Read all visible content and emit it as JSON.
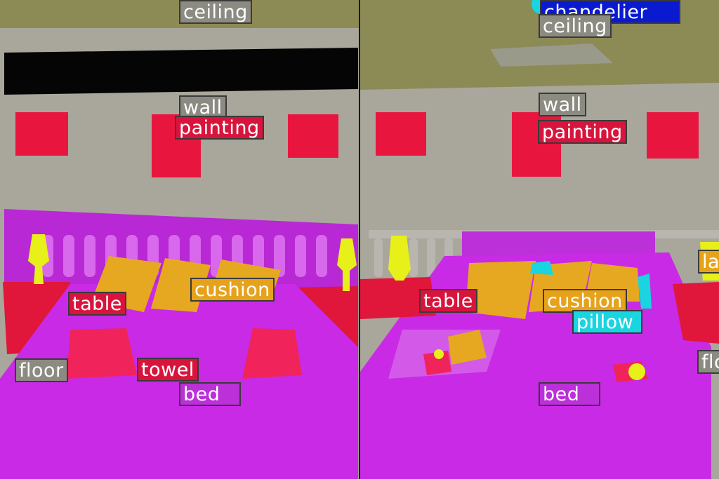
{
  "colors": {
    "wall": "#a9a79c",
    "ceiling": "#8c8a55",
    "painting": "#e8163f",
    "bed": "#c92ae6",
    "cushion": "#e6a820",
    "table": "#e0163a",
    "lamp": "#e8f01a",
    "pillow": "#1ad4e0",
    "chandelier": "#0a1ad0"
  },
  "left_panel": {
    "labels": {
      "ceiling": "ceiling",
      "wall": "wall",
      "painting": "painting",
      "cushion": "cushion",
      "table": "table",
      "floor": "floor",
      "towel": "towel",
      "bed": "bed"
    }
  },
  "right_panel": {
    "labels": {
      "chandelier": "chandelier",
      "ceiling": "ceiling",
      "wall": "wall",
      "painting": "painting",
      "table": "table",
      "cushion": "cushion",
      "pillow": "pillow",
      "bed": "bed",
      "lamp_partial": "la",
      "floor_partial": "flo"
    }
  }
}
